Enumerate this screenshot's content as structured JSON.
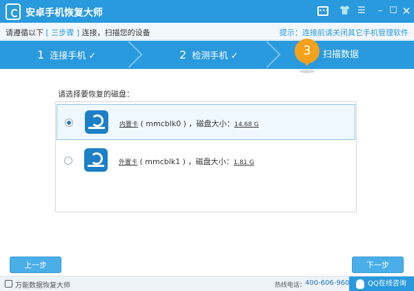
{
  "titlebar": {
    "title": "安卓手机恢复大师",
    "icons": [
      "chat-icon",
      "skin-icon",
      "menu-icon",
      "minimize-icon",
      "maximize-icon",
      "close-icon"
    ]
  },
  "toolbar": {
    "instruction_prefix": "请遵循以下",
    "instruction_highlight": "[ 三步骤 ]",
    "instruction_suffix": "连接，扫描您的设备",
    "tip": "提示：连接前请关闭其它手机管理软件"
  },
  "steps": [
    {
      "number": "1",
      "label": "连接手机",
      "check": "✓"
    },
    {
      "number": "2",
      "label": "检测手机",
      "check": "✓"
    },
    {
      "number": "3",
      "label": "扫描数据"
    }
  ],
  "main": {
    "select_label": "请选择要恢复的磁盘：",
    "disks": [
      {
        "type": "内置卡",
        "device": "( mmcblk0 )",
        "size_label": "，磁盘大小：",
        "size": "14.68 G",
        "selected": true
      },
      {
        "type": "外置卡",
        "device": "( mmcblk1 )",
        "size_label": "，磁盘大小：",
        "size": "1.81 G",
        "selected": false
      }
    ]
  },
  "buttons": {
    "prev": "上一步",
    "next": "下一步"
  },
  "statusbar": {
    "brand": "万能数据恢复大师",
    "hotline_label": "热线电话：",
    "hotline": "400-606-9600",
    "qq": "QQ在线咨询"
  },
  "colors": {
    "primary": "#2a9adf",
    "accent": "#f4a11c",
    "button": "#4aaee8"
  }
}
